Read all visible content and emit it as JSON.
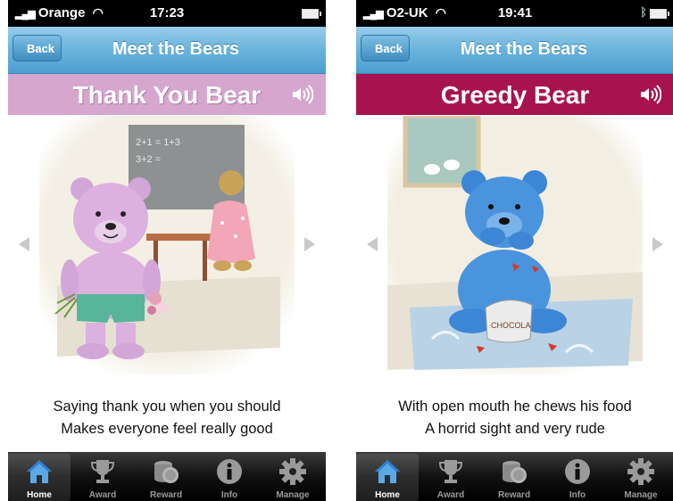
{
  "phones": [
    {
      "status": {
        "carrier": "Orange",
        "time": "17:23"
      },
      "nav": {
        "back_label": "Back",
        "title": "Meet the Bears"
      },
      "bear": {
        "name": "Thank You Bear",
        "banner_color": "#d7a6cf"
      },
      "rhyme": {
        "line1": "Saying thank you when you should",
        "line2": "Makes everyone feel really good"
      },
      "tabs": [
        {
          "label": "Home",
          "icon": "home-icon",
          "active": true
        },
        {
          "label": "Award",
          "icon": "trophy-icon",
          "active": false
        },
        {
          "label": "Reward",
          "icon": "coins-icon",
          "active": false
        },
        {
          "label": "Info",
          "icon": "info-icon",
          "active": false
        },
        {
          "label": "Manage",
          "icon": "gear-icon",
          "active": false
        }
      ]
    },
    {
      "status": {
        "carrier": "O2-UK",
        "time": "19:41"
      },
      "nav": {
        "back_label": "Back",
        "title": "Meet the Bears"
      },
      "bear": {
        "name": "Greedy Bear",
        "banner_color": "#a8134f"
      },
      "rhyme": {
        "line1": "With open mouth he chews his food",
        "line2": "A horrid sight and very rude"
      },
      "tabs": [
        {
          "label": "Home",
          "icon": "home-icon",
          "active": true
        },
        {
          "label": "Award",
          "icon": "trophy-icon",
          "active": false
        },
        {
          "label": "Reward",
          "icon": "coins-icon",
          "active": false
        },
        {
          "label": "Info",
          "icon": "info-icon",
          "active": false
        },
        {
          "label": "Manage",
          "icon": "gear-icon",
          "active": false
        }
      ]
    }
  ],
  "artwork": {
    "left": {
      "chalkboard": [
        "2+1 = 1+3",
        "3+2 ="
      ]
    },
    "right": {
      "bag_label": "CHOCOLA"
    }
  }
}
